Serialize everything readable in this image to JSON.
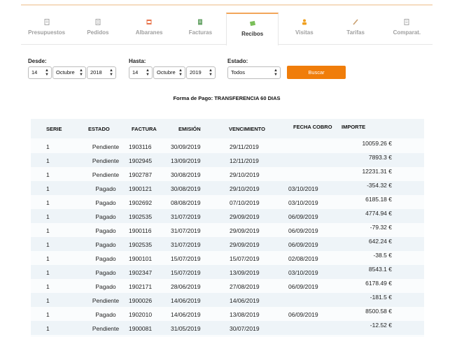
{
  "tabs": [
    {
      "label": "Presupuestos",
      "icon": "document-icon",
      "icon_color": "#9e9e9e",
      "active": false
    },
    {
      "label": "Pedidos",
      "icon": "list-document-icon",
      "icon_color": "#9e9e9e",
      "active": false
    },
    {
      "label": "Albaranes",
      "icon": "delivery-note-icon",
      "icon_color": "#e8734a",
      "active": false
    },
    {
      "label": "Facturas",
      "icon": "invoice-icon",
      "icon_color": "#6aa56a",
      "active": false
    },
    {
      "label": "Recibos",
      "icon": "receipt-icon",
      "icon_color": "#7bbf5a",
      "active": true
    },
    {
      "label": "Visitas",
      "icon": "visit-icon",
      "icon_color": "#f0a020",
      "active": false
    },
    {
      "label": "Tarifas",
      "icon": "pen-icon",
      "icon_color": "#c9a070",
      "active": false
    },
    {
      "label": "Comparat.",
      "icon": "compare-icon",
      "icon_color": "#9e9e9e",
      "active": false
    }
  ],
  "filters": {
    "desde_label": "Desde:",
    "desde_day": "14",
    "desde_month": "Octubre",
    "desde_year": "2018",
    "hasta_label": "Hasta:",
    "hasta_day": "14",
    "hasta_month": "Octubre",
    "hasta_year": "2019",
    "estado_label": "Estado:",
    "estado_value": "Todos",
    "search_label": "Buscar"
  },
  "payment_method": "Forma de Pago: TRANSFERENCIA 60 DIAS",
  "table": {
    "headers": [
      "SERIE",
      "ESTADO",
      "FACTURA",
      "EMISIÓN",
      "VENCIMIENTO",
      "FECHA COBRO",
      "IMPORTE"
    ],
    "rows": [
      [
        "1",
        "Pendiente",
        "1903116",
        "30/09/2019",
        "29/11/2019",
        "",
        "10059.26 €"
      ],
      [
        "1",
        "Pendiente",
        "1902945",
        "13/09/2019",
        "12/11/2019",
        "",
        "7893.3 €"
      ],
      [
        "1",
        "Pendiente",
        "1902787",
        "30/08/2019",
        "29/10/2019",
        "",
        "12231.31 €"
      ],
      [
        "1",
        "Pagado",
        "1900121",
        "30/08/2019",
        "29/10/2019",
        "03/10/2019",
        "-354.32 €"
      ],
      [
        "1",
        "Pagado",
        "1902692",
        "08/08/2019",
        "07/10/2019",
        "03/10/2019",
        "6185.18 €"
      ],
      [
        "1",
        "Pagado",
        "1902535",
        "31/07/2019",
        "29/09/2019",
        "06/09/2019",
        "4774.94 €"
      ],
      [
        "1",
        "Pagado",
        "1900116",
        "31/07/2019",
        "29/09/2019",
        "06/09/2019",
        "-79.32 €"
      ],
      [
        "1",
        "Pagado",
        "1902535",
        "31/07/2019",
        "29/09/2019",
        "06/09/2019",
        "642.24 €"
      ],
      [
        "1",
        "Pagado",
        "1900101",
        "15/07/2019",
        "15/07/2019",
        "02/08/2019",
        "-38.5 €"
      ],
      [
        "1",
        "Pagado",
        "1902347",
        "15/07/2019",
        "13/09/2019",
        "03/10/2019",
        "8543.1 €"
      ],
      [
        "1",
        "Pagado",
        "1902171",
        "28/06/2019",
        "27/08/2019",
        "06/09/2019",
        "6178.49 €"
      ],
      [
        "1",
        "Pendiente",
        "1900026",
        "14/06/2019",
        "14/06/2019",
        "",
        "-181.5 €"
      ],
      [
        "1",
        "Pagado",
        "1902010",
        "14/06/2019",
        "13/08/2019",
        "06/09/2019",
        "8500.58 €"
      ],
      [
        "1",
        "Pendiente",
        "1900081",
        "31/05/2019",
        "30/07/2019",
        "",
        "-12.52 €"
      ]
    ]
  }
}
